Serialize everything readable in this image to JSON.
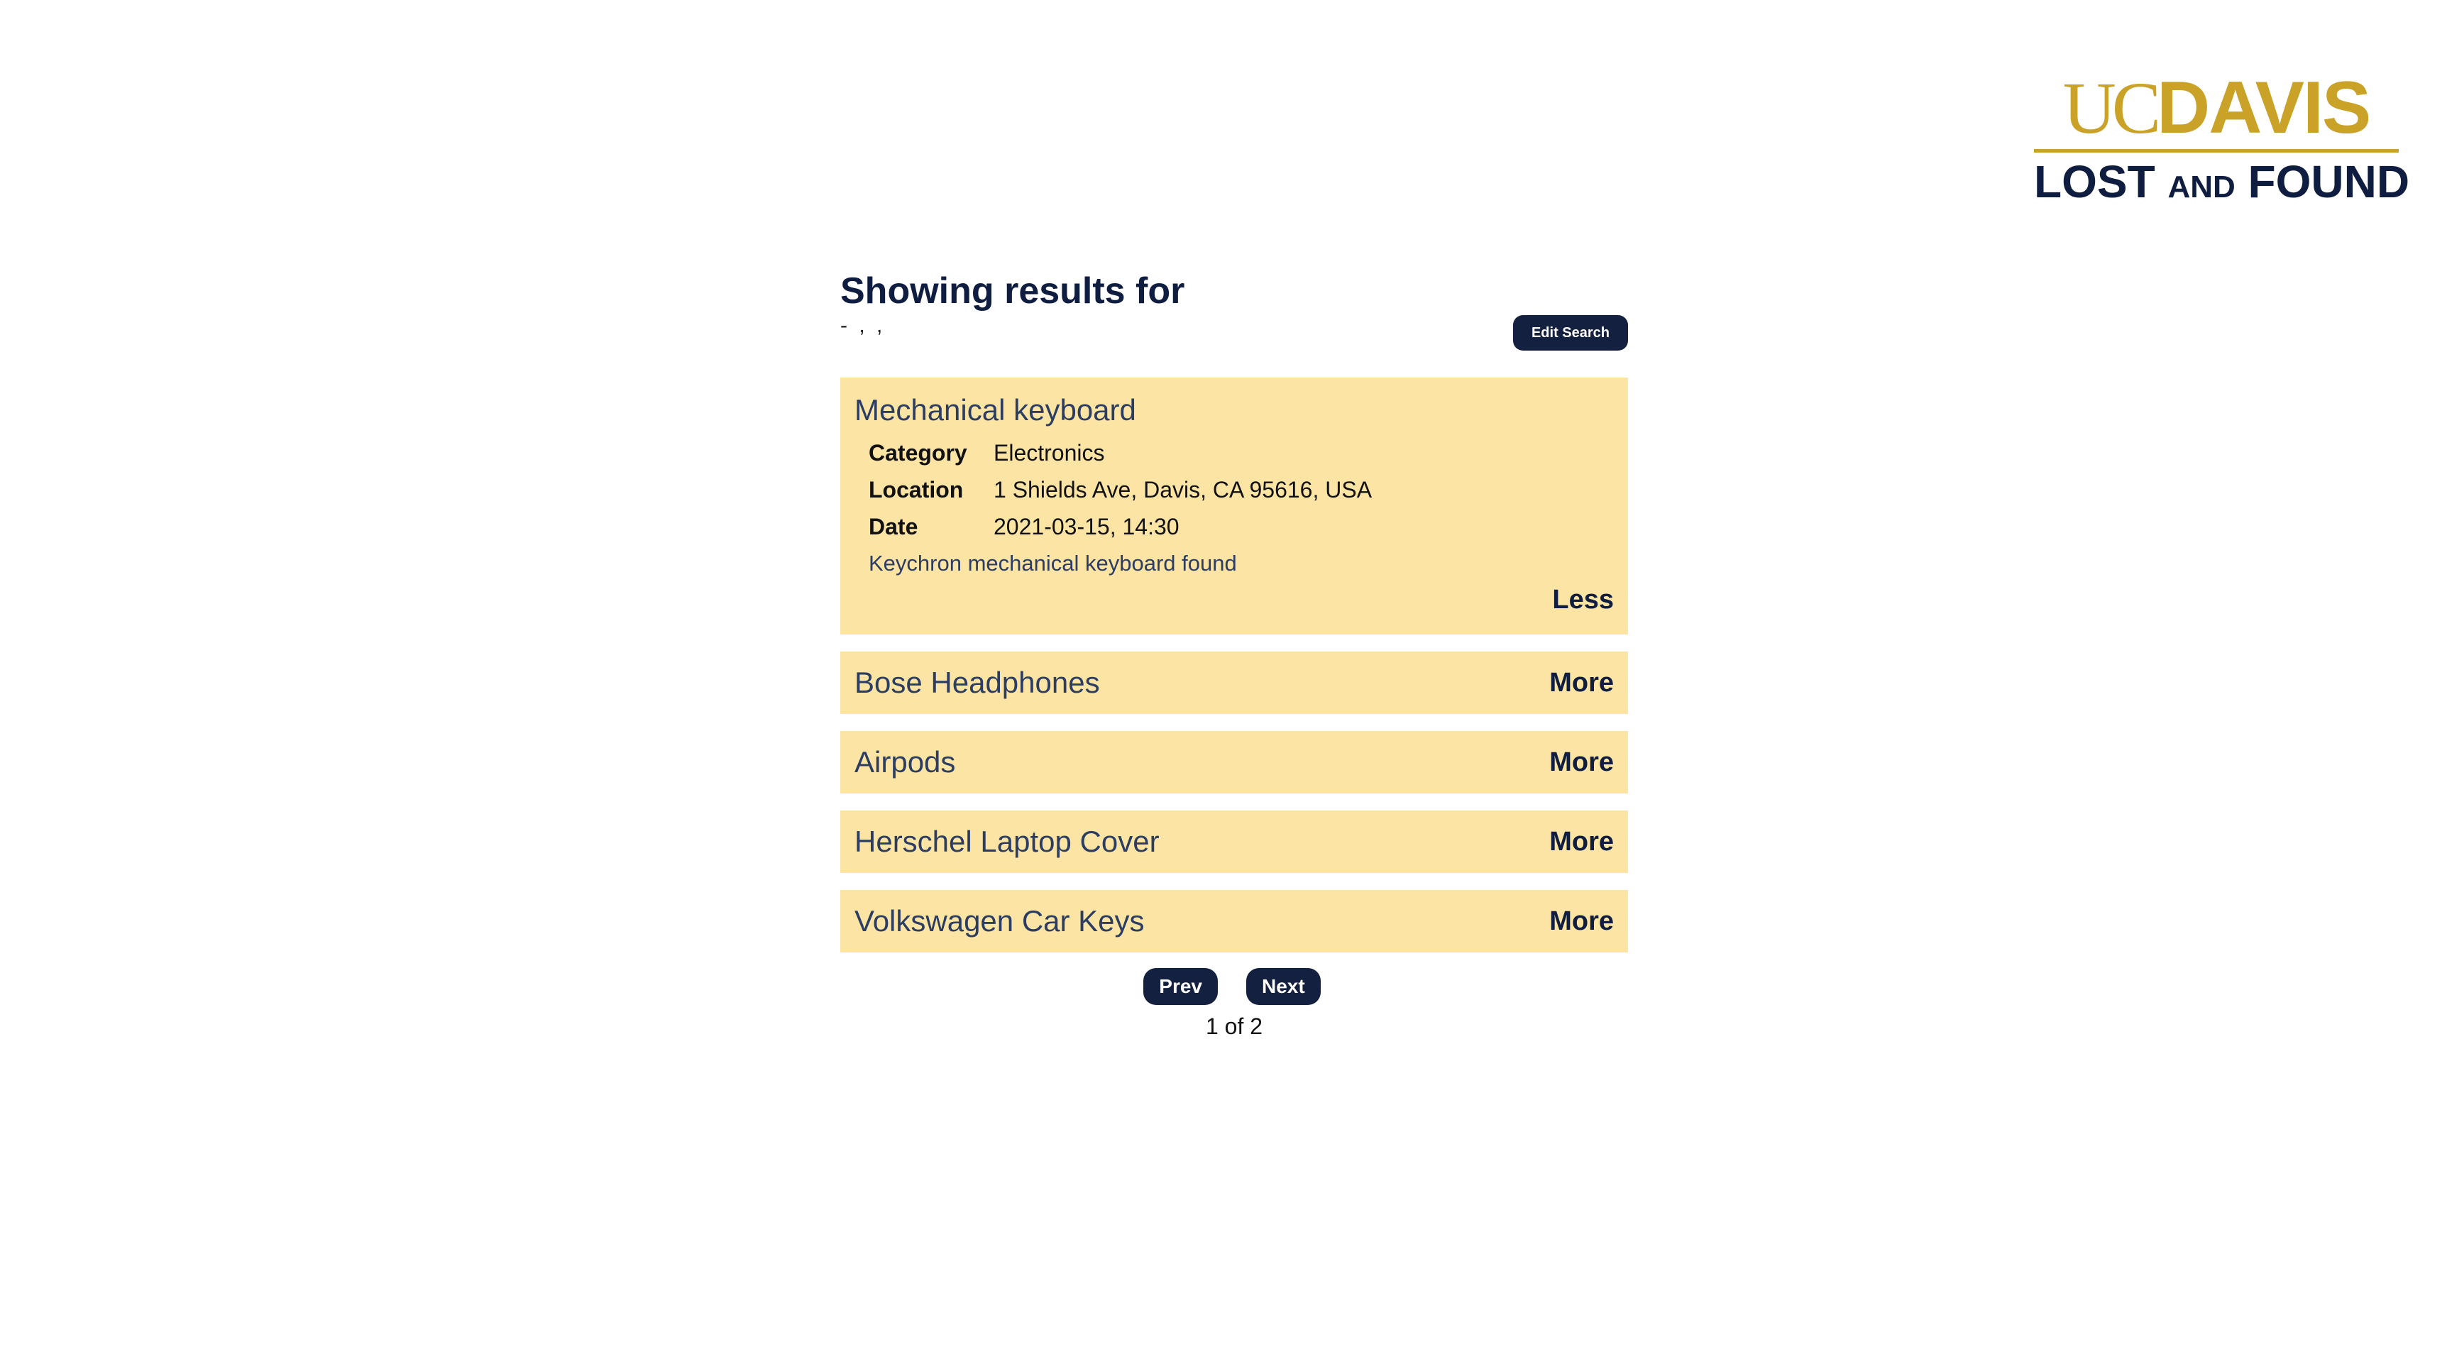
{
  "brand": {
    "logo_top_uc": "UC",
    "logo_top_davis": "DAVIS",
    "logo_bottom_lost": "LOST",
    "logo_bottom_and": "AND",
    "logo_bottom_found": "FOUND",
    "gold": "#C9A227",
    "navy": "#0F1E40"
  },
  "header": {
    "title": "Showing results for",
    "search_summary": "- , ,",
    "edit_search_label": "Edit Search"
  },
  "results": [
    {
      "title": "Mechanical keyboard",
      "expanded": true,
      "category_label": "Category",
      "category": "Electronics",
      "location_label": "Location",
      "location": "1 Shields Ave, Davis, CA 95616, USA",
      "date_label": "Date",
      "date": "2021-03-15, 14:30",
      "description": "Keychron mechanical keyboard found",
      "toggle_label": "Less"
    },
    {
      "title": "Bose Headphones",
      "expanded": false,
      "toggle_label": "More"
    },
    {
      "title": "Airpods",
      "expanded": false,
      "toggle_label": "More"
    },
    {
      "title": "Herschel Laptop Cover",
      "expanded": false,
      "toggle_label": "More"
    },
    {
      "title": "Volkswagen Car Keys",
      "expanded": false,
      "toggle_label": "More"
    }
  ],
  "pagination": {
    "prev_label": "Prev",
    "next_label": "Next",
    "indicator": "1 of 2"
  },
  "colors": {
    "card_bg": "#FCE5A4",
    "button_bg": "#13203F",
    "title_text": "#2B3D63"
  }
}
